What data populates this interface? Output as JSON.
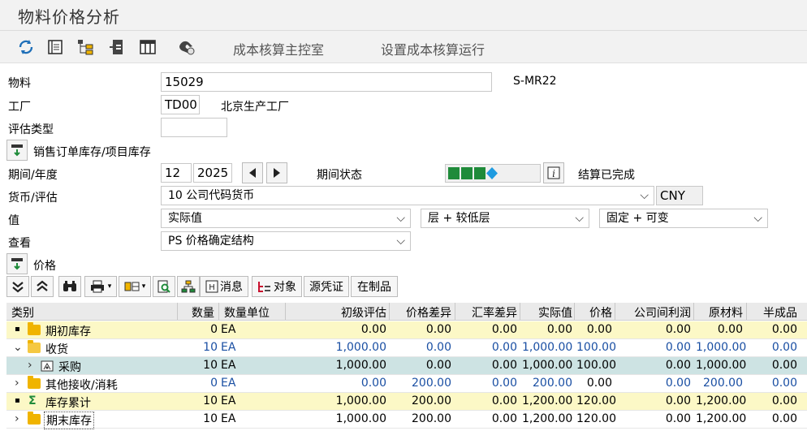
{
  "window": {
    "title": "物料价格分析"
  },
  "toolbar": {
    "icons": [
      "refresh-icon",
      "document-icon",
      "hierarchy-icon",
      "export-icon",
      "table-icon",
      "copy-hand-icon"
    ],
    "cost_cockpit": "成本核算主控室",
    "setup_run": "设置成本核算运行"
  },
  "form": {
    "material_label": "物料",
    "material_value": "15029",
    "material_desc": "S-MR22",
    "plant_label": "工厂",
    "plant_value": "TD00",
    "plant_desc": "北京生产工厂",
    "valtype_label": "评估类型",
    "valtype_value": "",
    "sales_order_label": "销售订单库存/项目库存",
    "period_label": "期间/年度",
    "period_value": "12",
    "year_value": "2025",
    "period_status_label": "期间状态",
    "status_text": "结算已完成",
    "currency_label": "货币/评估",
    "currency_value": "10 公司代码货币",
    "currency_code": "CNY",
    "value_label": "值",
    "value_select": "实际值",
    "level_select": "层 + 较低层",
    "fixvar_select": "固定 + 可变",
    "view_label": "查看",
    "view_select": "PS 价格确定结构",
    "price_label": "价格"
  },
  "grid_toolbar": {
    "messages": "消息",
    "objects": "对象",
    "source_docs": "源凭证",
    "wip": "在制品"
  },
  "grid": {
    "headers": {
      "category": "类别",
      "qty": "数量",
      "unit": "数量单位",
      "prelim": "初级评估",
      "pricediff": "价格差异",
      "exrate": "汇率差异",
      "actual": "实际值",
      "price": "价格",
      "icprofit": "公司间利润",
      "raw": "原材料",
      "semi": "半成品"
    },
    "rows": [
      {
        "category": "期初库存",
        "qty": "0",
        "unit": "EA",
        "prelim": "0.00",
        "pricediff": "0.00",
        "exrate": "0.00",
        "actual": "0.00",
        "price": "0.00",
        "icprofit": "0.00",
        "raw": "0.00",
        "semi": "0.00"
      },
      {
        "category": "收货",
        "qty": "10",
        "unit": "EA",
        "prelim": "1,000.00",
        "pricediff": "0.00",
        "exrate": "0.00",
        "actual": "1,000.00",
        "price": "100.00",
        "icprofit": "0.00",
        "raw": "1,000.00",
        "semi": "0.00"
      },
      {
        "category": "采购",
        "qty": "10",
        "unit": "EA",
        "prelim": "1,000.00",
        "pricediff": "0.00",
        "exrate": "0.00",
        "actual": "1,000.00",
        "price": "100.00",
        "icprofit": "0.00",
        "raw": "1,000.00",
        "semi": "0.00"
      },
      {
        "category": "其他接收/消耗",
        "qty": "0",
        "unit": "EA",
        "prelim": "0.00",
        "pricediff": "200.00",
        "exrate": "0.00",
        "actual": "200.00",
        "price": "0.00",
        "icprofit": "0.00",
        "raw": "200.00",
        "semi": "0.00"
      },
      {
        "category": "库存累计",
        "qty": "10",
        "unit": "EA",
        "prelim": "1,000.00",
        "pricediff": "200.00",
        "exrate": "0.00",
        "actual": "1,200.00",
        "price": "120.00",
        "icprofit": "0.00",
        "raw": "1,200.00",
        "semi": "0.00"
      },
      {
        "category": "期末库存",
        "qty": "10",
        "unit": "EA",
        "prelim": "1,000.00",
        "pricediff": "200.00",
        "exrate": "0.00",
        "actual": "1,200.00",
        "price": "120.00",
        "icprofit": "0.00",
        "raw": "1,200.00",
        "semi": "0.00"
      }
    ]
  }
}
